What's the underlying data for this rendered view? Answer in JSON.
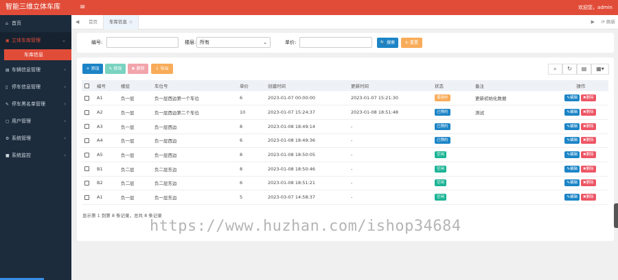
{
  "app": {
    "title": "智能三维立体车库",
    "menu_icon": "≡",
    "user_text": "欢迎您，admin"
  },
  "sidebar": {
    "items": [
      {
        "icon": "home-icon",
        "label": "首页",
        "chevron": ""
      },
      {
        "icon": "car-icon",
        "label": "立体车库管理",
        "chevron": "⌄"
      },
      {
        "icon": "list-icon",
        "label": "车辆信息管理",
        "chevron": "‹"
      },
      {
        "icon": "doc-icon",
        "label": "停车信息管理",
        "chevron": "‹"
      },
      {
        "icon": "wrench-icon",
        "label": "停车黑名单管理",
        "chevron": "‹"
      },
      {
        "icon": "user-icon",
        "label": "用户管理",
        "chevron": "‹"
      },
      {
        "icon": "gear-icon",
        "label": "系统管理",
        "chevron": "‹"
      },
      {
        "icon": "monitor-icon",
        "label": "系统监控",
        "chevron": "‹"
      }
    ],
    "sub_item": "车库信息"
  },
  "tabs": {
    "prev": "◀",
    "next": "▶",
    "home": "首页",
    "active": "车库信息",
    "refresh": "⟳ 刷新"
  },
  "search": {
    "code_label": "编号:",
    "floor_label": "楼层:",
    "floor_value": "所有",
    "price_label": "单价:",
    "search_btn": "🔍 搜索",
    "reset_btn": "↻ 重置"
  },
  "toolbar": {
    "add": "+ 添加",
    "edit": "✎ 修改",
    "delete": "✖ 删除",
    "export": "⇩ 导出"
  },
  "table": {
    "headers": [
      "",
      "编号",
      "楼层",
      "车位号",
      "单价",
      "创建时间",
      "更新时间",
      "状态",
      "备注",
      "操作"
    ],
    "rows": [
      {
        "code": "A1",
        "floor": "负一层",
        "spot": "负一层西边第一个车位",
        "price": "6",
        "created": "2023-01-07 00:00:00",
        "updated": "2023-01-07 15:21:30",
        "status": "使用中",
        "status_color": "#f8ac59",
        "remark": "更新初始化数据"
      },
      {
        "code": "A2",
        "floor": "负一层",
        "spot": "负一层西边第二个车位",
        "price": "10",
        "created": "2023-01-07 15:24:37",
        "updated": "2023-01-08 18:51:48",
        "status": "已预约",
        "status_color": "#1c84c6",
        "remark": "测试"
      },
      {
        "code": "A3",
        "floor": "负一层",
        "spot": "负一层西边",
        "price": "8",
        "created": "2023-01-08 18:49:14",
        "updated": "-",
        "status": "已预约",
        "status_color": "#1c84c6",
        "remark": ""
      },
      {
        "code": "A4",
        "floor": "负一层",
        "spot": "负一层西边",
        "price": "6",
        "created": "2023-01-08 18:49:36",
        "updated": "-",
        "status": "已预约",
        "status_color": "#1c84c6",
        "remark": ""
      },
      {
        "code": "A5",
        "floor": "负一层",
        "spot": "负一层西边",
        "price": "8",
        "created": "2023-01-08 18:50:05",
        "updated": "-",
        "status": "空闲",
        "status_color": "#1ab394",
        "remark": ""
      },
      {
        "code": "B1",
        "floor": "负二层",
        "spot": "负二层东边",
        "price": "8",
        "created": "2023-01-08 18:50:46",
        "updated": "-",
        "status": "空闲",
        "status_color": "#1ab394",
        "remark": ""
      },
      {
        "code": "B2",
        "floor": "负二层",
        "spot": "负二层东边",
        "price": "6",
        "created": "2023-01-08 18:51:21",
        "updated": "-",
        "status": "空闲",
        "status_color": "#1ab394",
        "remark": ""
      },
      {
        "code": "A1",
        "floor": "负一层",
        "spot": "负一层东边",
        "price": "5",
        "created": "2023-03-07 14:58:37",
        "updated": "-",
        "status": "空闲",
        "status_color": "#1ab394",
        "remark": ""
      }
    ],
    "edit_label": "✎编辑",
    "delete_label": "✖删除"
  },
  "pagination_text": "显示第 1 到第 8 条记录，总共 8 条记录",
  "watermark": "https://www.huzhan.com/ishop34684"
}
